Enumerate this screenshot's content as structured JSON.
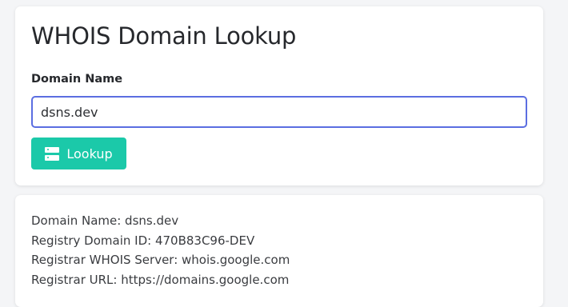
{
  "form": {
    "title": "WHOIS Domain Lookup",
    "field_label": "Domain Name",
    "domain_value": "dsns.dev",
    "button_label": "Lookup",
    "button_icon": "server-icon",
    "accent_color": "#1bc9a9",
    "focus_color": "#5b6ee1"
  },
  "result": {
    "lines": [
      "Domain Name: dsns.dev",
      "Registry Domain ID: 470B83C96-DEV",
      "Registrar WHOIS Server: whois.google.com",
      "Registrar URL: https://domains.google.com"
    ]
  }
}
